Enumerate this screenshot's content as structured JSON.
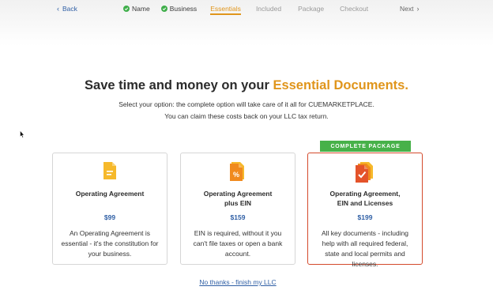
{
  "nav": {
    "back_label": "Back",
    "next_label": "Next",
    "steps": [
      {
        "label": "Name",
        "status": "done"
      },
      {
        "label": "Business",
        "status": "done"
      },
      {
        "label": "Essentials",
        "status": "active"
      },
      {
        "label": "Included",
        "status": "upcoming"
      },
      {
        "label": "Package",
        "status": "upcoming"
      },
      {
        "label": "Checkout",
        "status": "upcoming"
      }
    ]
  },
  "headline": {
    "main": "Save time and money on your ",
    "accent": "Essential Documents."
  },
  "subtitle": {
    "line1": "Select your option: the complete option will take care of it all for CUEMARKETPLACE.",
    "line2": "You can claim these costs back on your LLC tax return."
  },
  "cards": [
    {
      "title": "Operating Agreement",
      "price": "$99",
      "description": "An Operating Agreement is essential - it's the constitution for your business.",
      "icon": "document-icon"
    },
    {
      "title_line1": "Operating Agreement",
      "title_line2": "plus EIN",
      "price": "$159",
      "description": "EIN is required, without it you can't file taxes or open a bank account.",
      "icon": "percent-document-icon"
    },
    {
      "banner": "COMPLETE PACKAGE",
      "title_line1": "Operating Agreement,",
      "title_line2": "EIN and Licenses",
      "price": "$199",
      "description": "All key documents - including help with all required federal, state and local permits and licenses.",
      "icon": "stacked-check-documents-icon"
    }
  ],
  "no_thanks": "No thanks - finish my LLC",
  "colors": {
    "accent": "#e0951b",
    "link": "#2f5fa5",
    "success": "#3fae4a",
    "recommended_border": "#d44a2c",
    "banner": "#47b149"
  }
}
